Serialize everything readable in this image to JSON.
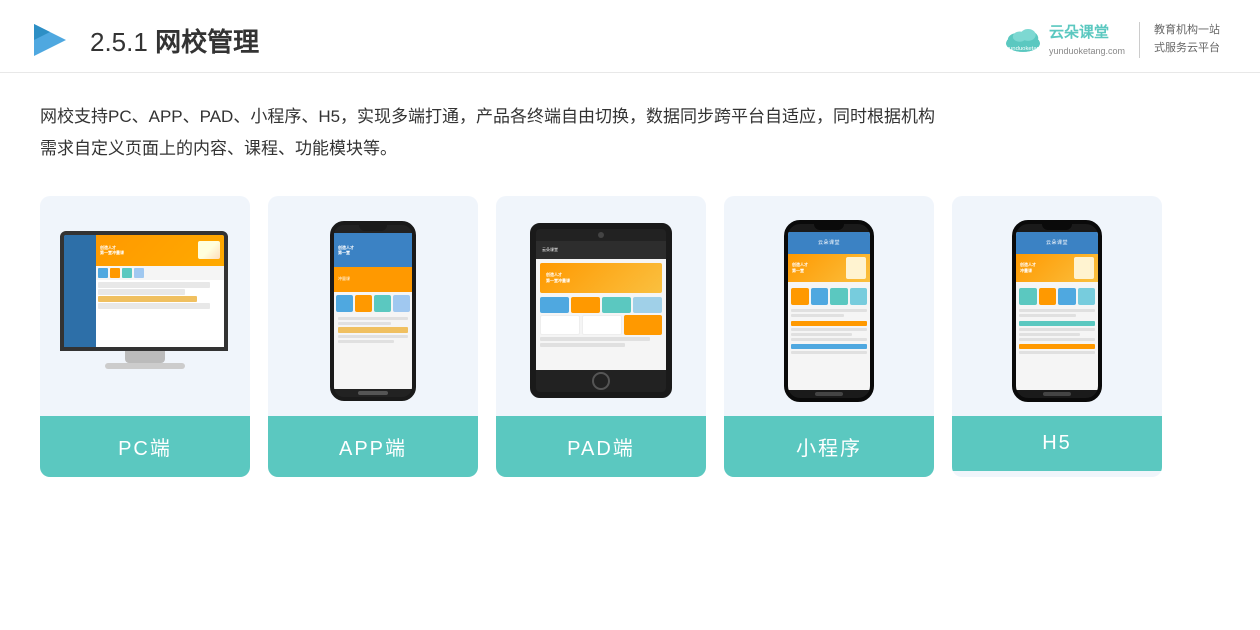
{
  "header": {
    "section_number": "2.5.1",
    "title_plain": "网校管理",
    "brand_name": "云朵课堂",
    "brand_url": "yunduoketang.com",
    "brand_tagline_line1": "教育机构一站",
    "brand_tagline_line2": "式服务云平台"
  },
  "description": {
    "text_line1": "网校支持PC、APP、PAD、小程序、H5，实现多端打通，产品各终端自由切换，数据同步跨平台自适应，同时根据机构",
    "text_line2": "需求自定义页面上的内容、课程、功能模块等。"
  },
  "cards": [
    {
      "id": "pc",
      "label": "PC端"
    },
    {
      "id": "app",
      "label": "APP端"
    },
    {
      "id": "pad",
      "label": "PAD端"
    },
    {
      "id": "miniprogram",
      "label": "小程序"
    },
    {
      "id": "h5",
      "label": "H5"
    }
  ],
  "colors": {
    "teal": "#5bc8c0",
    "blue": "#3b82c4",
    "orange": "#f90",
    "dark": "#222"
  }
}
